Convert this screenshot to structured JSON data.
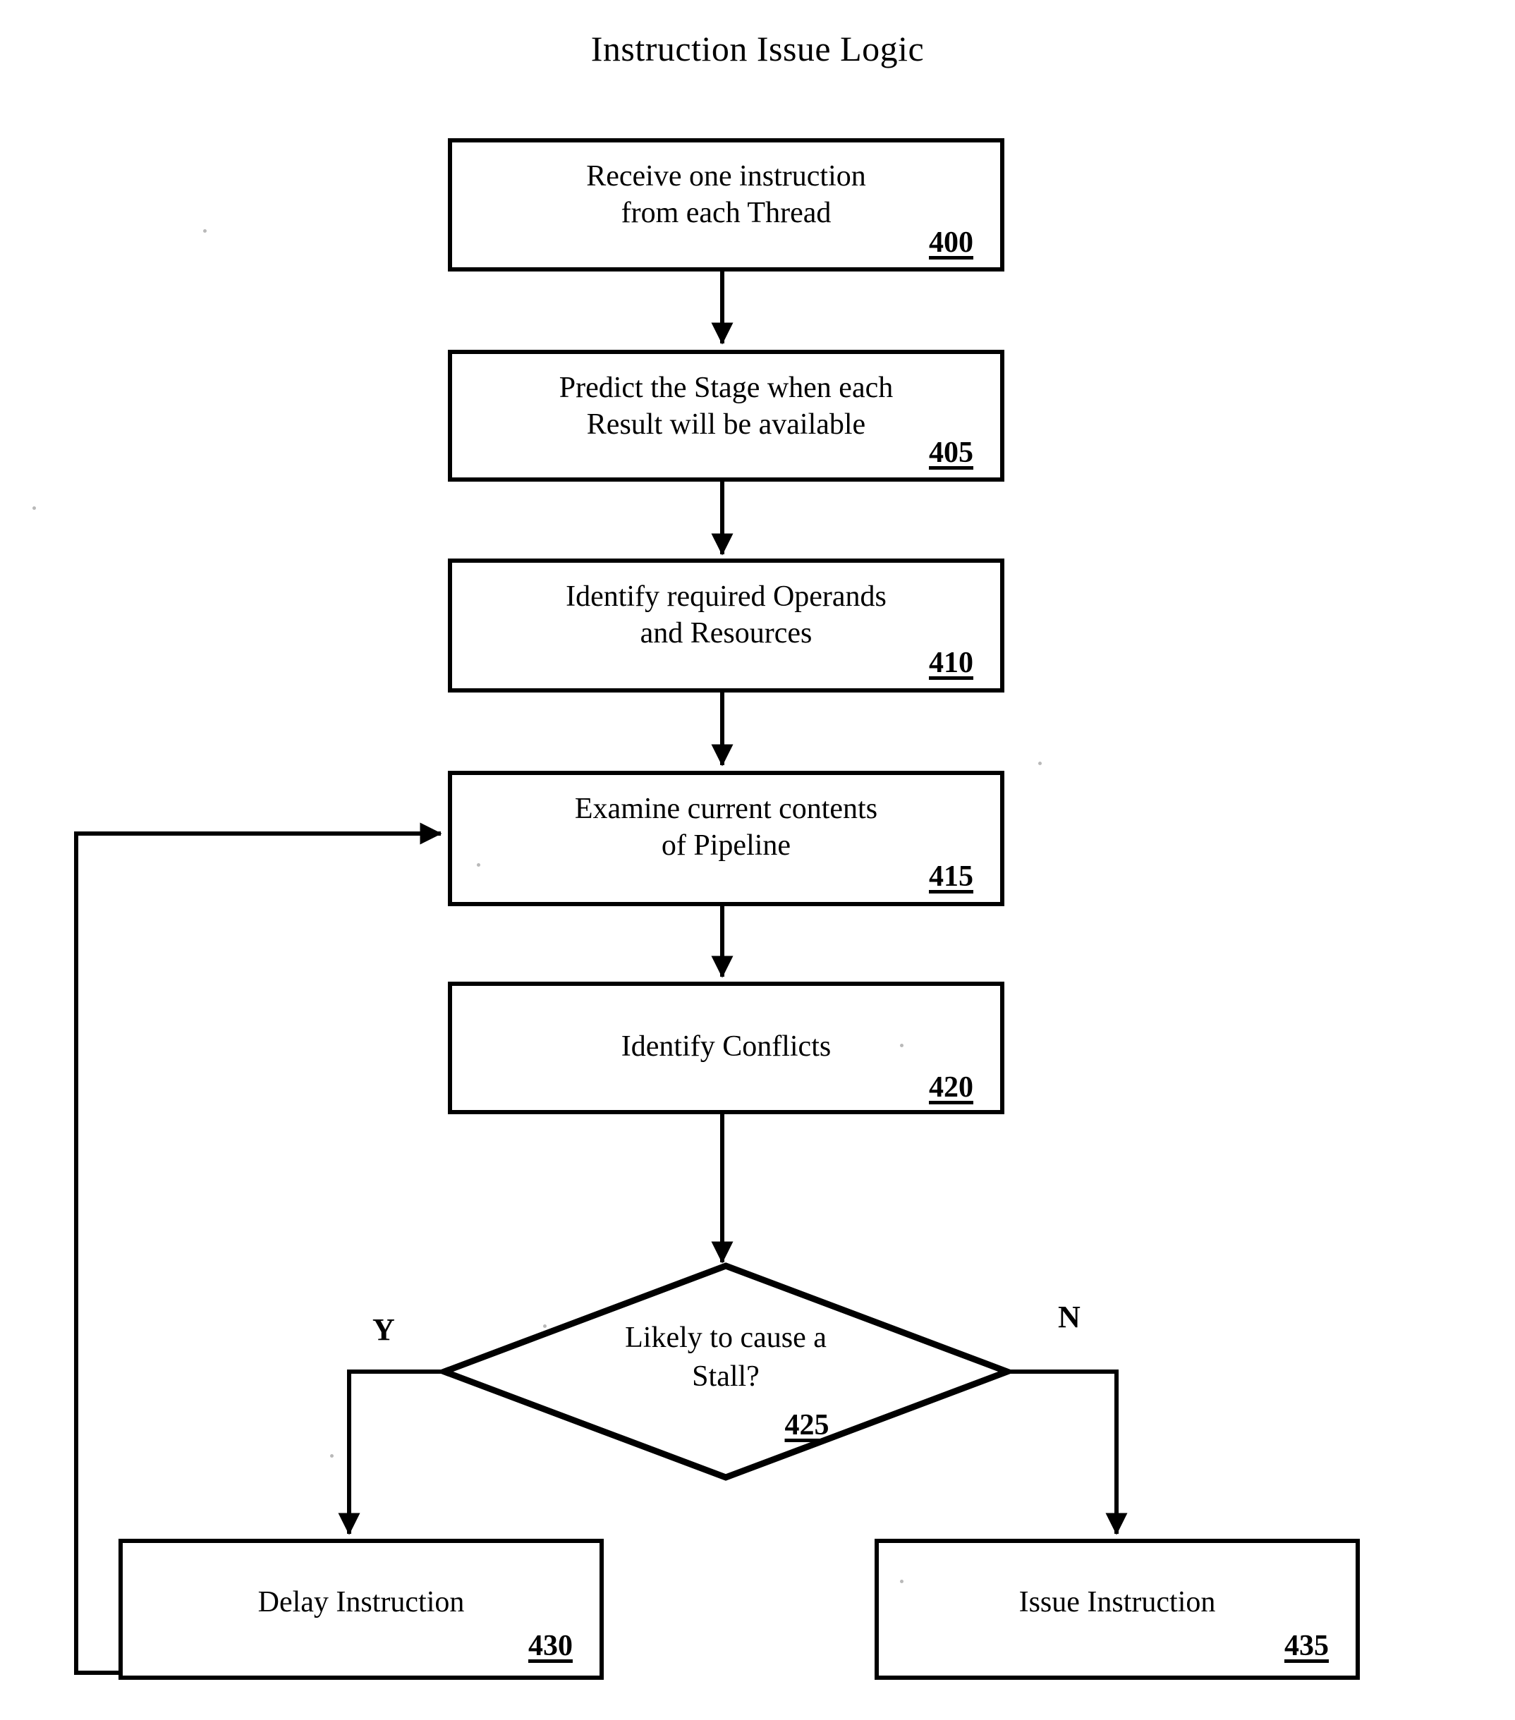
{
  "diagram": {
    "title": "Instruction Issue Logic",
    "type": "flowchart"
  },
  "nodes": [
    {
      "id": "n400",
      "shape": "process",
      "text": "Receive one instruction\nfrom each Thread",
      "ref": "400"
    },
    {
      "id": "n405",
      "shape": "process",
      "text": "Predict the Stage when each\nResult will be available",
      "ref": "405"
    },
    {
      "id": "n410",
      "shape": "process",
      "text": "Identify required Operands\nand Resources",
      "ref": "410"
    },
    {
      "id": "n415",
      "shape": "process",
      "text": "Examine current contents\nof Pipeline",
      "ref": "415"
    },
    {
      "id": "n420",
      "shape": "process",
      "text": "Identify Conflicts",
      "ref": "420"
    },
    {
      "id": "n425",
      "shape": "decision",
      "text": "Likely to cause a\nStall?",
      "ref": "425"
    },
    {
      "id": "n430",
      "shape": "process",
      "text": "Delay Instruction",
      "ref": "430"
    },
    {
      "id": "n435",
      "shape": "process",
      "text": "Issue Instruction",
      "ref": "435"
    }
  ],
  "branch_labels": {
    "yes": "Y",
    "no": "N"
  },
  "edges": [
    {
      "from": "n400",
      "to": "n405",
      "label": ""
    },
    {
      "from": "n405",
      "to": "n410",
      "label": ""
    },
    {
      "from": "n410",
      "to": "n415",
      "label": ""
    },
    {
      "from": "n415",
      "to": "n420",
      "label": ""
    },
    {
      "from": "n420",
      "to": "n425",
      "label": ""
    },
    {
      "from": "n425",
      "to": "n430",
      "label": "Y"
    },
    {
      "from": "n425",
      "to": "n435",
      "label": "N"
    },
    {
      "from": "n430",
      "to": "n415",
      "label": ""
    }
  ],
  "style": {
    "line_color": "#000000",
    "background": "#ffffff",
    "text_color": "#000000"
  }
}
